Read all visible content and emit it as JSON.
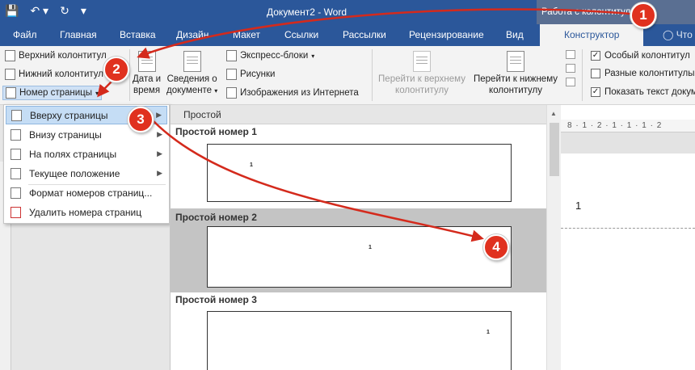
{
  "titlebar": {
    "doc_title": "Документ2 - Word",
    "context_group": "Работа с колонтитулами"
  },
  "tabs": {
    "file": "Файл",
    "home": "Главная",
    "insert": "Вставка",
    "design": "Дизайн",
    "layout": "Макет",
    "references": "Ссылки",
    "mailings": "Рассылки",
    "review": "Рецензирование",
    "view": "Вид",
    "constructor": "Конструктор",
    "tell_me": "Что"
  },
  "ribbon": {
    "header": "Верхний колонтитул",
    "footer": "Нижний колонтитул",
    "page_number": "Номер страницы",
    "date_time_1": "Дата и",
    "date_time_2": "время",
    "doc_info_1": "Сведения о",
    "doc_info_2": "документе",
    "quick_parts": "Экспресс-блоки",
    "pictures": "Рисунки",
    "online_pictures": "Изображения из Интернета",
    "goto_header_1": "Перейти к верхнему",
    "goto_header_2": "колонтитулу",
    "goto_footer_1": "Перейти к нижнему",
    "goto_footer_2": "колонтитулу",
    "opt_diff_first": "Особый колонтитул",
    "opt_odd_even": "Разные колонтитулы",
    "opt_show_text": "Показать текст документа",
    "opt_diff_first_checked": true,
    "opt_odd_even_checked": false,
    "opt_show_text_checked": true
  },
  "menu": {
    "items": [
      {
        "label": "Вверху страницы",
        "submenu": true
      },
      {
        "label": "Внизу страницы",
        "submenu": true
      },
      {
        "label": "На полях страницы",
        "submenu": true
      },
      {
        "label": "Текущее положение",
        "submenu": true
      },
      {
        "label": "Формат номеров страниц...",
        "submenu": false
      },
      {
        "label": "Удалить номера страниц",
        "submenu": false
      }
    ]
  },
  "gallery": {
    "header": "Простой",
    "items": [
      {
        "label": "Простой номер 1",
        "number": "1"
      },
      {
        "label": "Простой номер 2",
        "number": "1"
      },
      {
        "label": "Простой номер 3",
        "number": "1"
      }
    ]
  },
  "document": {
    "ruler": "8 · 1 · 2 · 1 · 1 · 1 · 2",
    "page_number": "1"
  },
  "callouts": [
    "1",
    "2",
    "3",
    "4"
  ],
  "colors": {
    "word_blue": "#2b579a",
    "callout_red": "#e0311f",
    "arrow_red": "#d42a1c",
    "highlight": "#c5ddf5"
  }
}
